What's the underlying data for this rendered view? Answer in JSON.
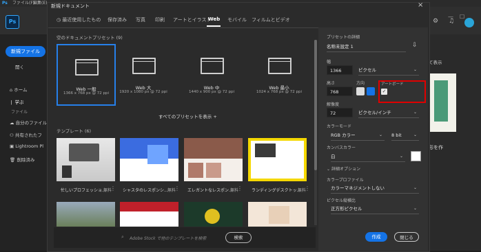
{
  "menubar": {
    "items": [
      "ファイル(F)",
      "編集(E)"
    ]
  },
  "app": {
    "logo": "Ps",
    "new_file": "新規ファイル",
    "open": "開く"
  },
  "left_nav": {
    "items": [
      {
        "label": "ホーム",
        "icon": "home-icon"
      },
      {
        "label": "学ぶ",
        "icon": "lightbulb-icon"
      },
      {
        "label": "ファイル",
        "icon": ""
      },
      {
        "label": "自分のファイル",
        "icon": "cloud-icon"
      },
      {
        "label": "共有されたフ",
        "icon": "share-icon"
      },
      {
        "label": "Lightroom Pl",
        "icon": "lightroom-icon"
      },
      {
        "label": "削除済み",
        "icon": "trash-icon"
      }
    ]
  },
  "right_bg": {
    "show_label": "て表示",
    "create_text": "形を作"
  },
  "dialog": {
    "title": "新規ドキュメント",
    "tabs": [
      "最近使用したもの",
      "保存済み",
      "写真",
      "印刷",
      "アートとイラスト",
      "Web",
      "モバイル",
      "フィルムとビデオ"
    ],
    "active_tab": "Web",
    "blank_presets_title": "空のドキュメントプリセット (9)",
    "presets": [
      {
        "name": "Web 一般",
        "size": "1366 x 768 px @ 72 ppi",
        "selected": true
      },
      {
        "name": "Web 大",
        "size": "1920 x 1080 px @ 72 ppi",
        "selected": false
      },
      {
        "name": "Web 中",
        "size": "1440 x 900 px @ 72 ppi",
        "selected": false
      },
      {
        "name": "Web 最小",
        "size": "1024 x 768 px @ 72 ppi",
        "selected": false
      }
    ],
    "show_all": "すべてのプリセットを表示 +",
    "templates_title": "テンプレート (6)",
    "templates": [
      {
        "name": "忙しいプロフェッショ...",
        "price": "無料"
      },
      {
        "name": "シャスタのレスポンシ...",
        "price": "無料"
      },
      {
        "name": "エレガントなレスポン...",
        "price": "無料"
      },
      {
        "name": "ランディングデスクトッ...",
        "price": "無料"
      }
    ],
    "search_placeholder": "Adobe Stock で他のテンプレートを検索",
    "search_button": "検索",
    "details": {
      "header": "プリセットの詳細",
      "name": "名称未設定 1",
      "width_label": "幅",
      "width": "1366",
      "width_unit": "ピクセル",
      "height_label": "高さ",
      "height": "768",
      "orientation_label": "方向",
      "artboard_label": "アートボード",
      "artboard_checked": true,
      "resolution_label": "解像度",
      "resolution": "72",
      "resolution_unit": "ピクセル/インチ",
      "color_mode_label": "カラーモード",
      "color_mode": "RGB カラー",
      "bit_depth": "8 bit",
      "background_label": "カンバスカラー",
      "background": "白",
      "advanced": "詳細オプション",
      "color_profile_label": "カラープロファイル",
      "color_profile": "カラーマネジメントしない",
      "pixel_aspect_label": "ピクセル縦横比",
      "pixel_aspect": "正方形ピクセル",
      "create": "作成",
      "close": "閉じる"
    }
  },
  "colors": {
    "accent": "#1473e6",
    "highlight": "#e00000"
  }
}
